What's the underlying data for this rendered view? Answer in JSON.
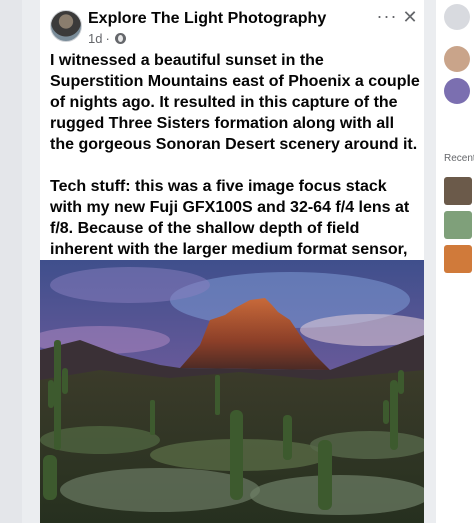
{
  "post": {
    "page_name": "Explore The Light Photography",
    "time": "1d",
    "separator": "·",
    "more_icon_glyph": "···",
    "close_icon_glyph": "✕",
    "paragraphs": [
      "I witnessed a beautiful sunset in the Superstition Mountains east of Phoenix a couple of nights ago. It resulted in this capture of the rugged Three Sisters formation along with all the gorgeous Sonoran Desert scenery around it.",
      "Tech stuff: this was a five image focus stack with my new Fuji GFX100S and 32-64 f/4 lens at f/8. Because of the shallow depth of field inherent with the larger medium format sensor, I'll be shooting a lot of focus stacks from now on."
    ]
  },
  "sidebar": {
    "recent_label": "Recent"
  },
  "icons": {
    "avatar": "avatar",
    "globe": "globe-icon",
    "more": "more-icon",
    "close": "close-icon"
  },
  "colors": {
    "text": "#050505",
    "secondary_text": "#65676b",
    "background": "#ebedf0"
  }
}
